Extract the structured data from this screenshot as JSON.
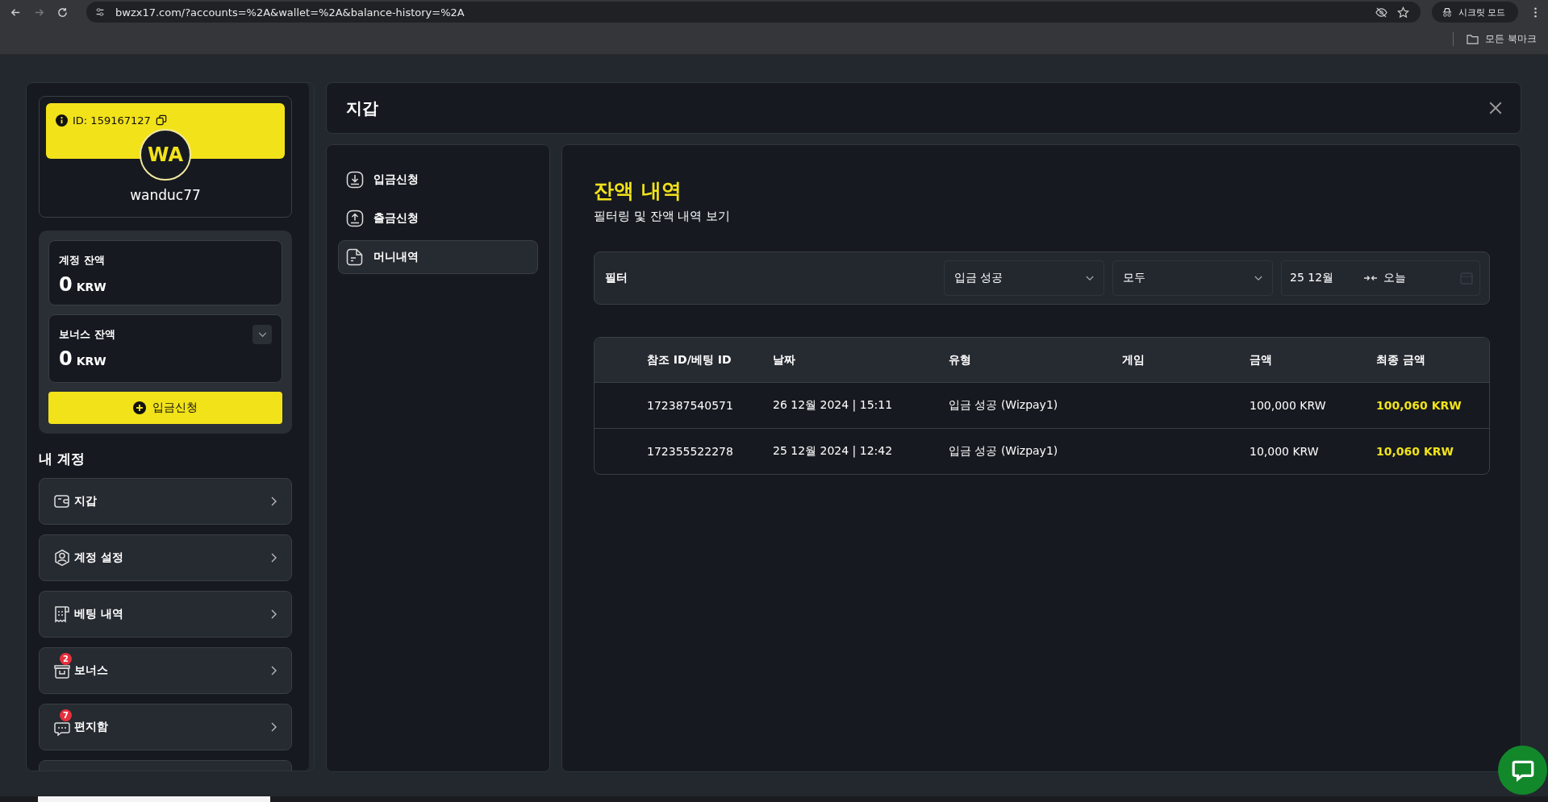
{
  "browser": {
    "url": "bwzx17.com/?accounts=%2A&wallet=%2A&balance-history=%2A",
    "incognito_label": "시크릿 모드",
    "bookmarks_label": "모든 북마크"
  },
  "profile": {
    "id": "ID: 159167127",
    "initials": "WA",
    "username": "wanduc77"
  },
  "balances": [
    {
      "label": "계정 잔액",
      "amount": "0",
      "currency": "KRW",
      "expandable": false
    },
    {
      "label": "보너스 잔액",
      "amount": "0",
      "currency": "KRW",
      "expandable": true
    }
  ],
  "deposit_button": "입금신청",
  "account_menu": {
    "heading": "내 계정",
    "items": [
      {
        "kind": "wallet",
        "label": "지갑"
      },
      {
        "kind": "user",
        "label": "계정 설정"
      },
      {
        "kind": "receipt",
        "label": "베팅 내역"
      },
      {
        "kind": "gift",
        "label": "보너스",
        "badge": "2"
      },
      {
        "kind": "chat",
        "label": "편지함",
        "badge": "7"
      }
    ]
  },
  "panel": {
    "title": "지갑"
  },
  "nav": [
    {
      "kind": "download",
      "label": "입금신청",
      "selected": false
    },
    {
      "kind": "upload",
      "label": "출금신청",
      "selected": false
    },
    {
      "kind": "document",
      "label": "머니내역",
      "selected": true
    }
  ],
  "content": {
    "title": "잔액 내역",
    "subtitle": "필터링 및 잔액 내역 보기"
  },
  "filter": {
    "label": "필터",
    "status": "입금 성공",
    "type": "모두",
    "date_from": "25 12월",
    "date_to": "오늘"
  },
  "table": {
    "columns": [
      "참조 ID/베팅 ID",
      "날짜",
      "유형",
      "게임",
      "금액",
      "최종 금액"
    ],
    "rows": [
      {
        "ref": "172387540571",
        "date": "26 12월 2024 | 15:11",
        "type": "입금 성공 (Wizpay1)",
        "amount": "100,000 KRW",
        "final_amount": "100,060 KRW"
      },
      {
        "ref": "172355522278",
        "date": "25 12월 2024 | 12:42",
        "type": "입금 성공 (Wizpay1)",
        "amount": "10,000 KRW",
        "final_amount": "10,060 KRW"
      }
    ]
  }
}
